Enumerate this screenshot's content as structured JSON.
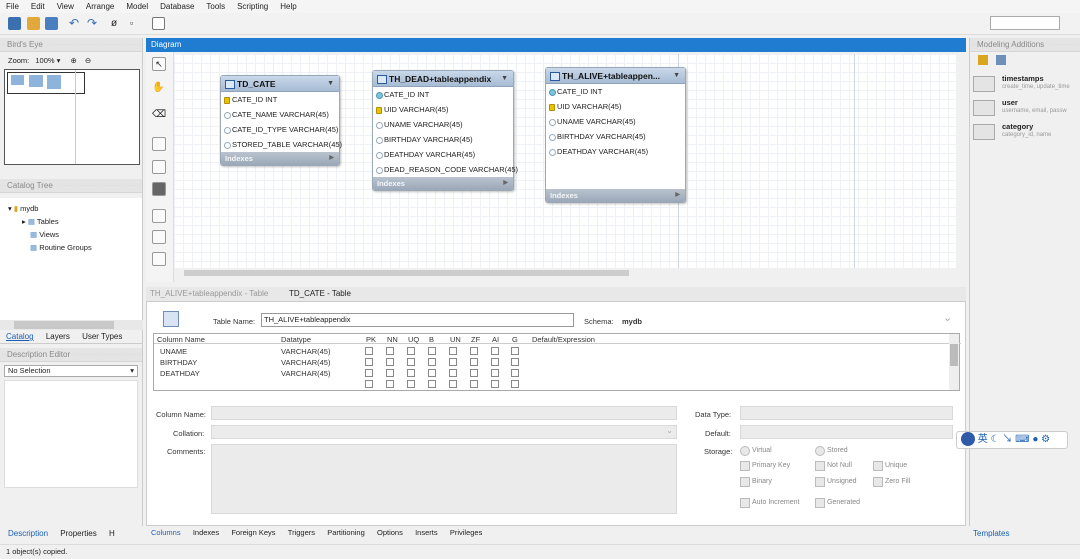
{
  "menu": [
    "File",
    "Edit",
    "View",
    "Arrange",
    "Model",
    "Database",
    "Tools",
    "Scripting",
    "Help"
  ],
  "birds_eye": {
    "title": "Bird's Eye",
    "zoom_label": "Zoom:",
    "zoom_value": "100%"
  },
  "catalog": {
    "title": "Catalog Tree",
    "db": "mydb",
    "items": [
      "Tables",
      "Views",
      "Routine Groups"
    ]
  },
  "side_tabs": [
    "Catalog",
    "Layers",
    "User Types"
  ],
  "desc": {
    "title": "Description Editor",
    "select": "No Selection"
  },
  "bottom_left_tabs": [
    "Description",
    "Properties",
    "H"
  ],
  "diagram_title": "Diagram",
  "entities": [
    {
      "name": "TD_CATE",
      "cols": [
        "CATE_ID INT",
        "CATE_NAME VARCHAR(45)",
        "CATE_ID_TYPE VARCHAR(45)",
        "STORED_TABLE VARCHAR(45)"
      ],
      "footer": "Indexes"
    },
    {
      "name": "TH_DEAD+tableappendix",
      "cols": [
        "CATE_ID INT",
        "UID VARCHAR(45)",
        "UNAME VARCHAR(45)",
        "BIRTHDAY VARCHAR(45)",
        "DEATHDAY VARCHAR(45)",
        "DEAD_REASON_CODE VARCHAR(45)"
      ],
      "footer": "Indexes"
    },
    {
      "name": "TH_ALIVE+tableappen...",
      "cols": [
        "CATE_ID INT",
        "UID VARCHAR(45)",
        "UNAME VARCHAR(45)",
        "BIRTHDAY VARCHAR(45)",
        "DEATHDAY VARCHAR(45)"
      ],
      "footer": "Indexes"
    }
  ],
  "doc_tabs": [
    "TH_ALIVE+tableappendix - Table",
    "TD_CATE - Table"
  ],
  "editor": {
    "table_name_label": "Table Name:",
    "table_name": "TH_ALIVE+tableappendix",
    "schema_label": "Schema:",
    "schema": "mydb",
    "headers": [
      "Column Name",
      "Datatype",
      "PK",
      "NN",
      "UQ",
      "B",
      "UN",
      "ZF",
      "AI",
      "G",
      "Default/Expression"
    ],
    "rows": [
      {
        "name": "UNAME",
        "type": "VARCHAR(45)"
      },
      {
        "name": "BIRTHDAY",
        "type": "VARCHAR(45)"
      },
      {
        "name": "DEATHDAY",
        "type": "VARCHAR(45)"
      }
    ],
    "column_name_label": "Column Name:",
    "collation_label": "Collation:",
    "comments_label": "Comments:",
    "datatype_label": "Data Type:",
    "default_label": "Default:",
    "storage_label": "Storage:",
    "storage_opts": [
      "Virtual",
      "Stored"
    ],
    "flags": [
      "Primary Key",
      "Not Null",
      "Unique",
      "Binary",
      "Unsigned",
      "Zero Fill",
      "Auto Increment",
      "Generated"
    ]
  },
  "editor_tabs": [
    "Columns",
    "Indexes",
    "Foreign Keys",
    "Triggers",
    "Partitioning",
    "Options",
    "Inserts",
    "Privileges"
  ],
  "modeling": {
    "title": "Modeling Additions",
    "items": [
      {
        "name": "timestamps",
        "sub": "create_time, update_time"
      },
      {
        "name": "user",
        "sub": "username, email, passw"
      },
      {
        "name": "category",
        "sub": "category_id, name"
      }
    ],
    "tab": "Templates"
  },
  "ime": "英",
  "status": "1 object(s) copied."
}
